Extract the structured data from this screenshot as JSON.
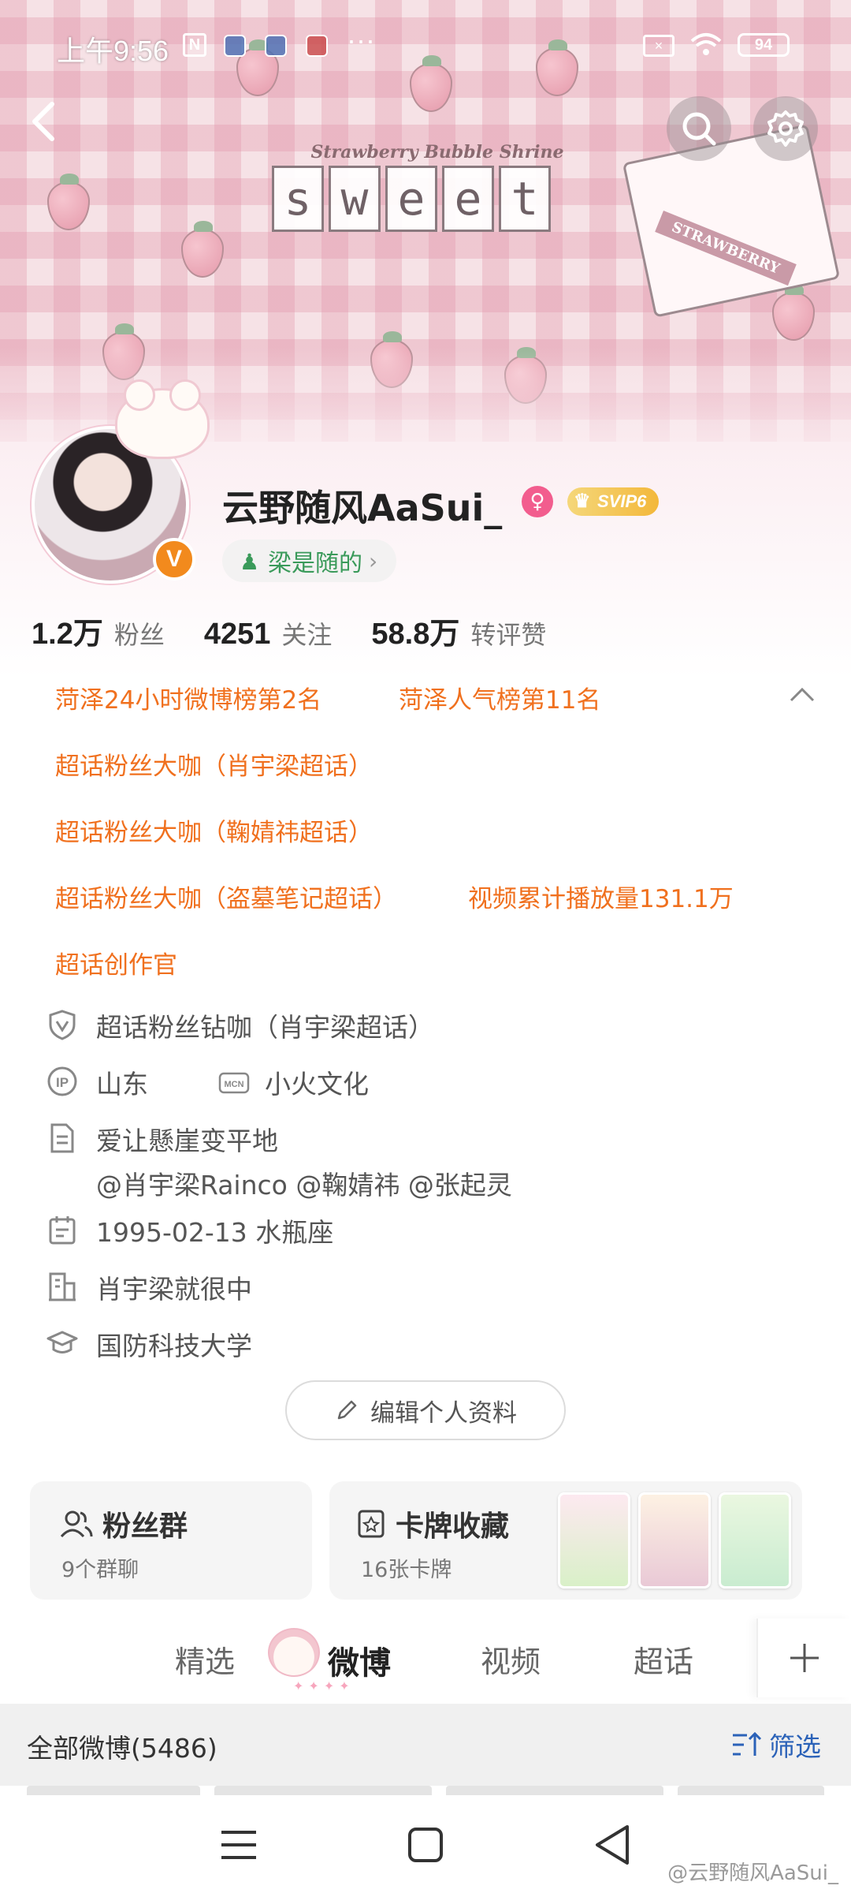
{
  "status_bar": {
    "time": "上午9:56",
    "battery": "94",
    "more": "···"
  },
  "banner": {
    "subtitle": "Strawberry Bubble Shrine",
    "letters": [
      "s",
      "w",
      "e",
      "e",
      "t"
    ],
    "box_label": "STRAWBERRY"
  },
  "profile": {
    "name": "云野随风AaSui_",
    "vip": "SVIP6",
    "verified_mark": "V",
    "tag": "梁是随的",
    "stats": [
      {
        "num": "1.2万",
        "label": "粉丝"
      },
      {
        "num": "4251",
        "label": "关注"
      },
      {
        "num": "58.8万",
        "label": "转评赞"
      }
    ]
  },
  "honors": [
    "菏泽24小时微博榜第2名",
    "菏泽人气榜第11名",
    "超话粉丝大咖（肖宇梁超话）",
    "超话粉丝大咖（鞠婧祎超话）",
    "超话粉丝大咖（盗墓笔记超话）",
    "视频累计播放量131.1万",
    "超话创作官"
  ],
  "info": {
    "badge": "超话粉丝钻咖（肖宇梁超话）",
    "ip_location": "山东",
    "mcn_label": "MCN",
    "mcn": "小火文化",
    "bio_line1": "爱让懸崖变平地",
    "bio_line2": "@肖宇梁Rainco @鞠婧祎 @张起灵",
    "birthday": "1995-02-13 水瓶座",
    "company": "肖宇梁就很中",
    "school": "国防科技大学"
  },
  "edit_button": "编辑个人资料",
  "cards": {
    "fans_title": "粉丝群",
    "fans_sub": "9个群聊",
    "cards_title": "卡牌收藏",
    "cards_sub": "16张卡牌"
  },
  "tabs": [
    "精选",
    "微博",
    "视频",
    "超话"
  ],
  "active_tab": "微博",
  "filter_bar": {
    "all": "全部微博(5486)",
    "filter": "筛选"
  },
  "watermark": "@云野随风AaSui_",
  "colors": {
    "honor": "#f0701e",
    "accent_blue": "#2b62b8",
    "verified": "#f28a1d",
    "tag_green": "#3a9a5a"
  },
  "icons": [
    "back-icon",
    "search-icon",
    "gear-icon",
    "shield-icon",
    "ip-icon",
    "mcn-icon",
    "doc-icon",
    "calendar-icon",
    "building-icon",
    "graduation-cap-icon",
    "pencil-icon",
    "group-icon",
    "card-icon",
    "plus-icon",
    "filter-icon",
    "menu-icon",
    "home-icon",
    "back-triangle-icon"
  ]
}
